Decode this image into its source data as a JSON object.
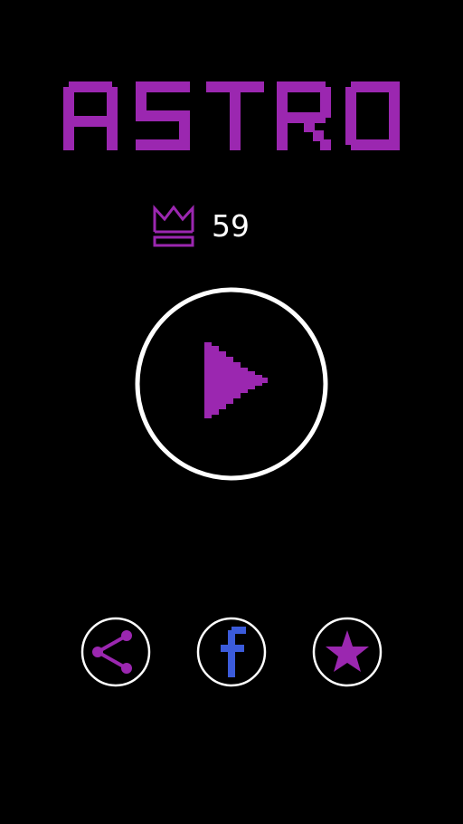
{
  "game": {
    "title": "ASTRO",
    "best_score": "59"
  },
  "colors": {
    "background": "#000000",
    "accent": "#9b27b0",
    "facebook": "#3b5bdb",
    "outline": "#ffffff"
  },
  "icons": {
    "crown": "crown-icon",
    "play": "play-icon",
    "share": "share-icon",
    "facebook": "facebook-icon",
    "rate": "star-icon"
  }
}
